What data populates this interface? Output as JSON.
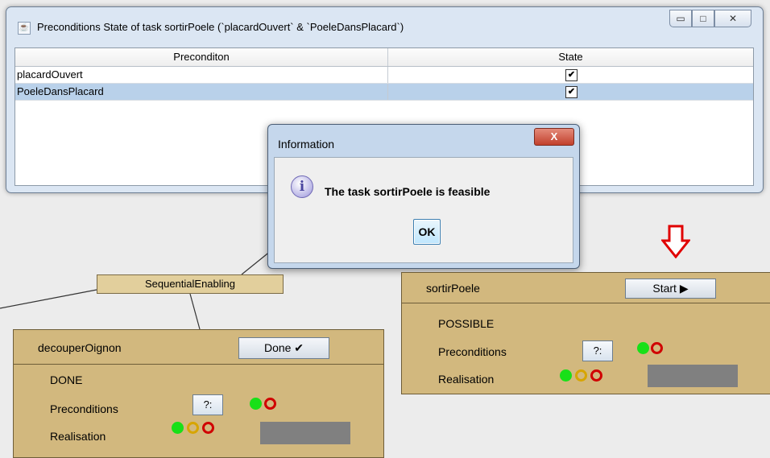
{
  "preconditions_window": {
    "title": "Preconditions State of task sortirPoele  (`placardOuvert` & `PoeleDansPlacard`)",
    "controls": [
      "minimize",
      "maximize",
      "close"
    ],
    "table": {
      "columns": [
        "Preconditon",
        "State"
      ],
      "rows": [
        {
          "precondition": "placardOuvert",
          "state": "✔",
          "selected": false
        },
        {
          "precondition": "PoeleDansPlacard",
          "state": "✔",
          "selected": true
        }
      ]
    }
  },
  "info_dialog": {
    "title": "Information",
    "close_label": "X",
    "icon": "info-icon",
    "icon_glyph": "i",
    "message": "The task sortirPoele is feasible",
    "ok_label": "OK"
  },
  "operator": {
    "label": "SequentialEnabling"
  },
  "tasks": {
    "sortirPoele": {
      "name": "sortirPoele",
      "button_label": "Start ▶",
      "state": "POSSIBLE",
      "preconditions_label": "Preconditions",
      "preconditions_button": "?:",
      "realisation_label": "Realisation"
    },
    "decouperOignon": {
      "name": "decouperOignon",
      "button_label": "Done ✔",
      "state": "DONE",
      "preconditions_label": "Preconditions",
      "preconditions_button": "?:",
      "realisation_label": "Realisation"
    }
  },
  "colors": {
    "task_card": "#d2b87e",
    "operator_node": "#e2cf9c",
    "indicator_green": "#18e018",
    "indicator_red": "#d00000",
    "indicator_yellow": "#d7a500",
    "highlight_arrow": "#e00000"
  }
}
